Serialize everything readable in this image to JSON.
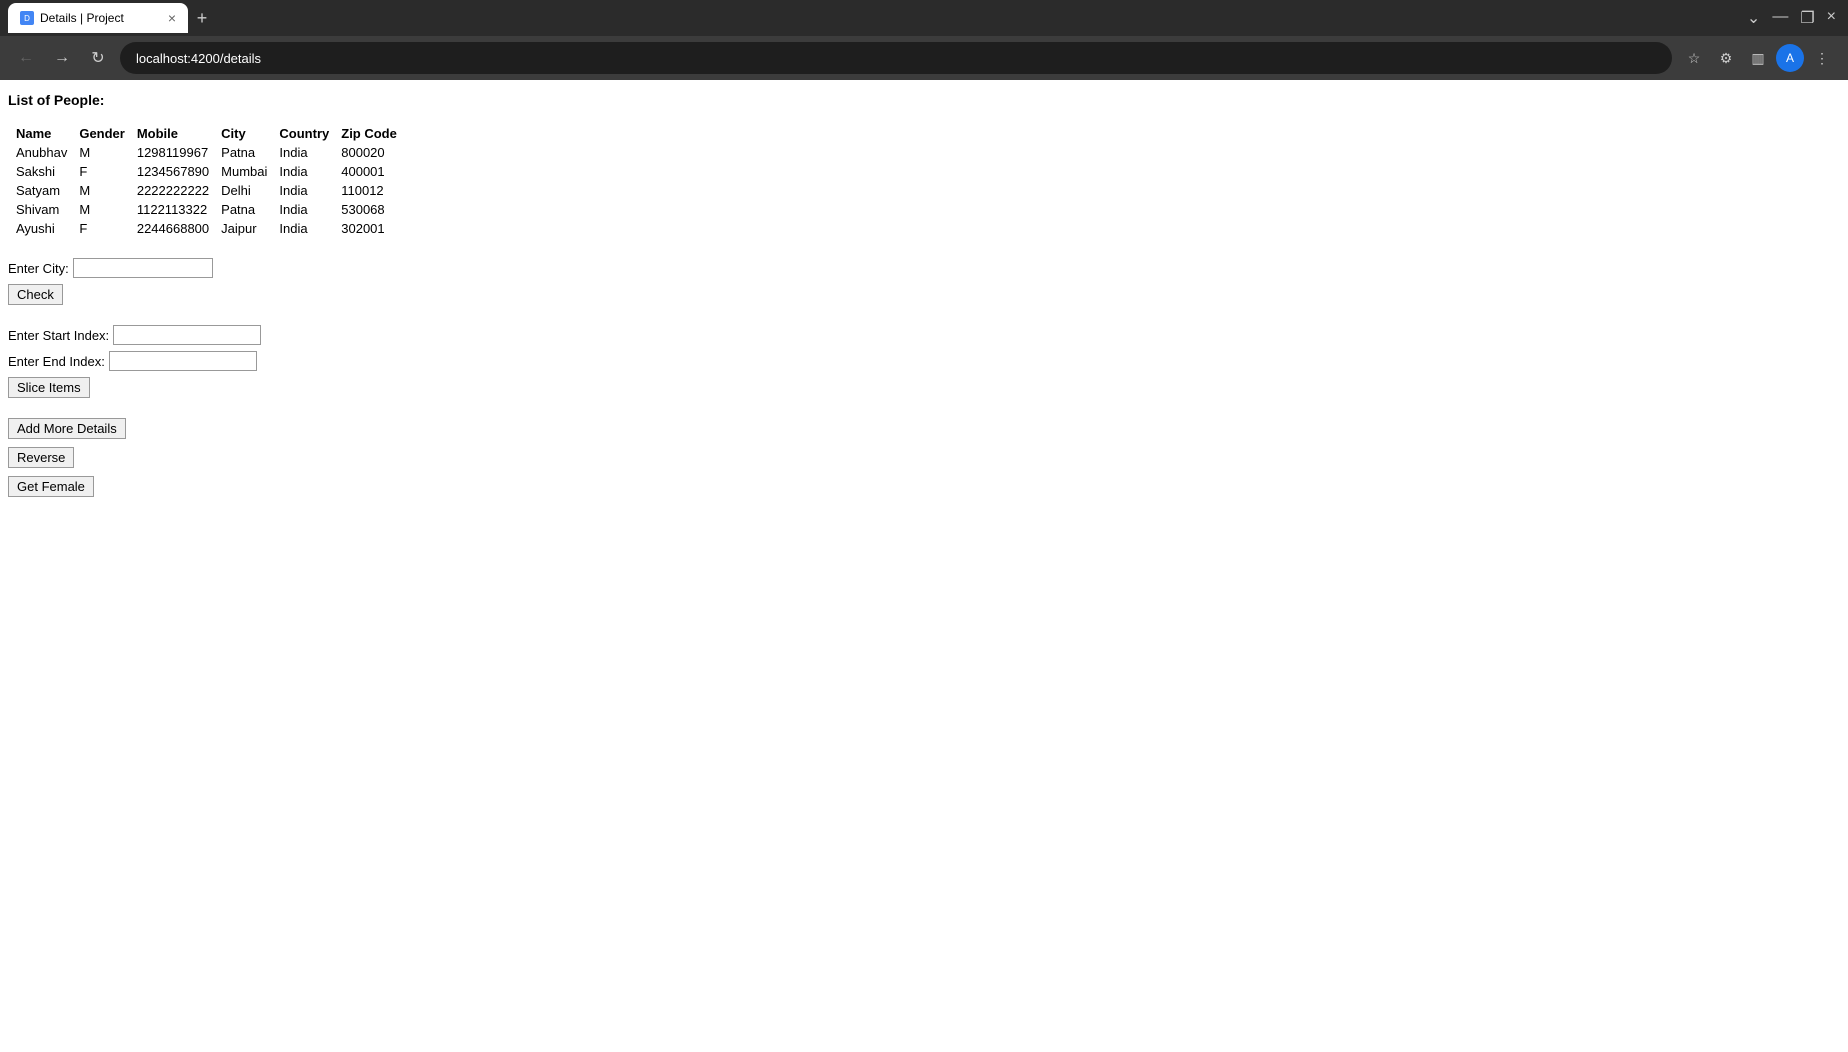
{
  "browser": {
    "tab": {
      "title": "Details | Project",
      "favicon": "D"
    },
    "address": "localhost:4200/details"
  },
  "page": {
    "title": "List of People:",
    "table": {
      "headers": [
        "Name",
        "Gender",
        "Mobile",
        "City",
        "Country",
        "Zip Code"
      ],
      "rows": [
        [
          "Anubhav",
          "M",
          "1298119967",
          "Patna",
          "India",
          "800020"
        ],
        [
          "Sakshi",
          "F",
          "1234567890",
          "Mumbai",
          "India",
          "400001"
        ],
        [
          "Satyam",
          "M",
          "2222222222",
          "Delhi",
          "India",
          "110012"
        ],
        [
          "Shivam",
          "M",
          "1122113322",
          "Patna",
          "India",
          "530068"
        ],
        [
          "Ayushi",
          "F",
          "2244668800",
          "Jaipur",
          "India",
          "302001"
        ]
      ]
    },
    "city_filter": {
      "label": "Enter City:",
      "placeholder": "",
      "check_button": "Check"
    },
    "slice": {
      "start_label": "Enter Start Index:",
      "end_label": "Enter End Index:",
      "start_placeholder": "",
      "end_placeholder": "",
      "button": "Slice Items"
    },
    "add_details_button": "Add More Details",
    "reverse_button": "Reverse",
    "get_female_button": "Get Female"
  }
}
